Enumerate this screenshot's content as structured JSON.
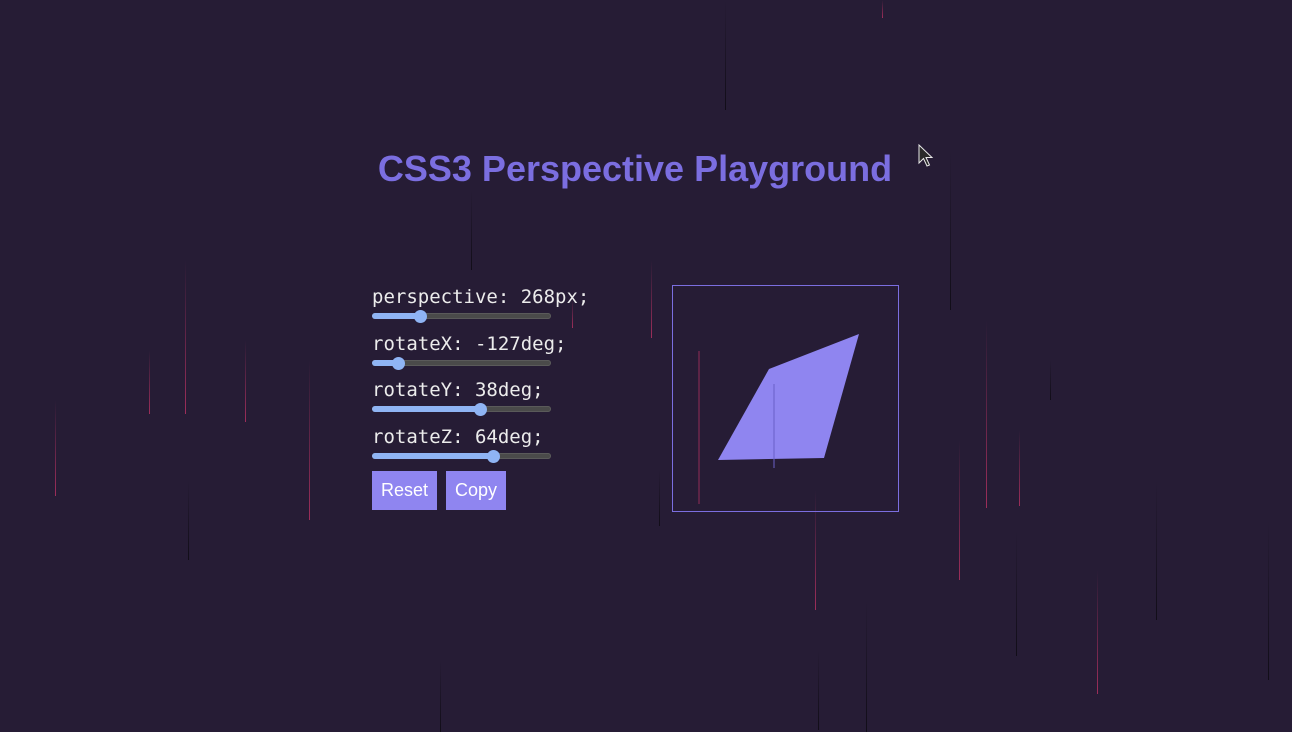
{
  "app": {
    "title": "CSS3 Perspective Playground"
  },
  "controls": [
    {
      "property": "perspective",
      "value": 268,
      "unit": "px",
      "label": "perspective: 268px;",
      "min": 0,
      "max": 1000
    },
    {
      "property": "rotateX",
      "value": -127,
      "unit": "deg",
      "label": "rotateX: -127deg;",
      "min": -180,
      "max": 180
    },
    {
      "property": "rotateY",
      "value": 38,
      "unit": "deg",
      "label": "rotateY: 38deg;",
      "min": -180,
      "max": 180
    },
    {
      "property": "rotateZ",
      "value": 64,
      "unit": "deg",
      "label": "rotateZ: 64deg;",
      "min": -180,
      "max": 180
    }
  ],
  "buttons": {
    "reset_label": "Reset",
    "copy_label": "Copy"
  },
  "colors": {
    "background": "#261c35",
    "accent": "#7b6ee0",
    "shape_fill": "#8f85f0",
    "slider_fill": "#8fb4f4",
    "button_bg": "#8f85f0"
  },
  "icons": {
    "cursor": "mouse-pointer-icon"
  }
}
